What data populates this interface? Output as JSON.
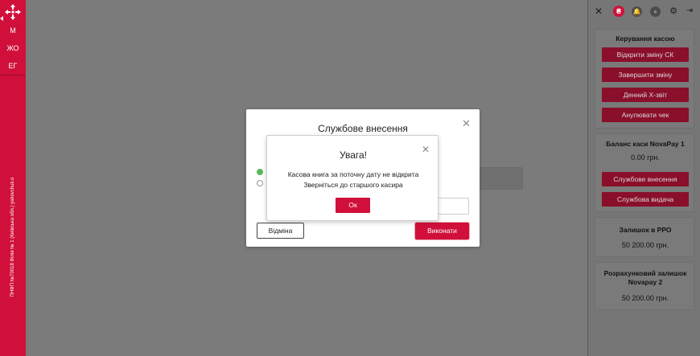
{
  "sidebar": {
    "items": [
      {
        "label": "М"
      },
      {
        "label": "ЖО"
      },
      {
        "label": "ЕГ"
      }
    ],
    "vertical_text": "ПНФП №70018 Філія № 1 (Київська обл.) yakovchuk.o"
  },
  "background_input": {
    "placeholder": "По"
  },
  "right_panel": {
    "toolbar": {
      "close_icon": "✕",
      "brand_icon": "₴",
      "notifications_icon": "🔔",
      "user_icon": "●",
      "settings_icon": "⚙",
      "logout_icon": "⇥"
    },
    "cash_control": {
      "title": "Керування касою",
      "buttons": [
        "Відкрити зміну СК",
        "Завершити зміну",
        "Денний X-звіт",
        "Анулювати чек"
      ]
    },
    "balance": {
      "title": "Баланс каси NovaPay 1",
      "value": "0.00 грн.",
      "buttons": [
        "Службове внесення",
        "Службова видача"
      ]
    },
    "rro_balance": {
      "title": "Залишок в РРО",
      "value": "50 200.00 грн."
    },
    "settlement_balance": {
      "title": "Розрахунковий залишок Novapay 2",
      "value": "50 200.00 грн."
    }
  },
  "service_deposit_modal": {
    "title": "Службове внесення",
    "close": "✕",
    "cancel_label": "Відміна",
    "execute_label": "Виконати"
  },
  "alert_modal": {
    "title": "Увага!",
    "close": "✕",
    "message_line1": "Касова книга за поточну дату не відкрита",
    "message_line2": "Зверніться до старшого касира",
    "ok_label": "Ок"
  },
  "colors": {
    "brand_red": "#d0103a",
    "overlay_gray": "#7b7b7b"
  }
}
